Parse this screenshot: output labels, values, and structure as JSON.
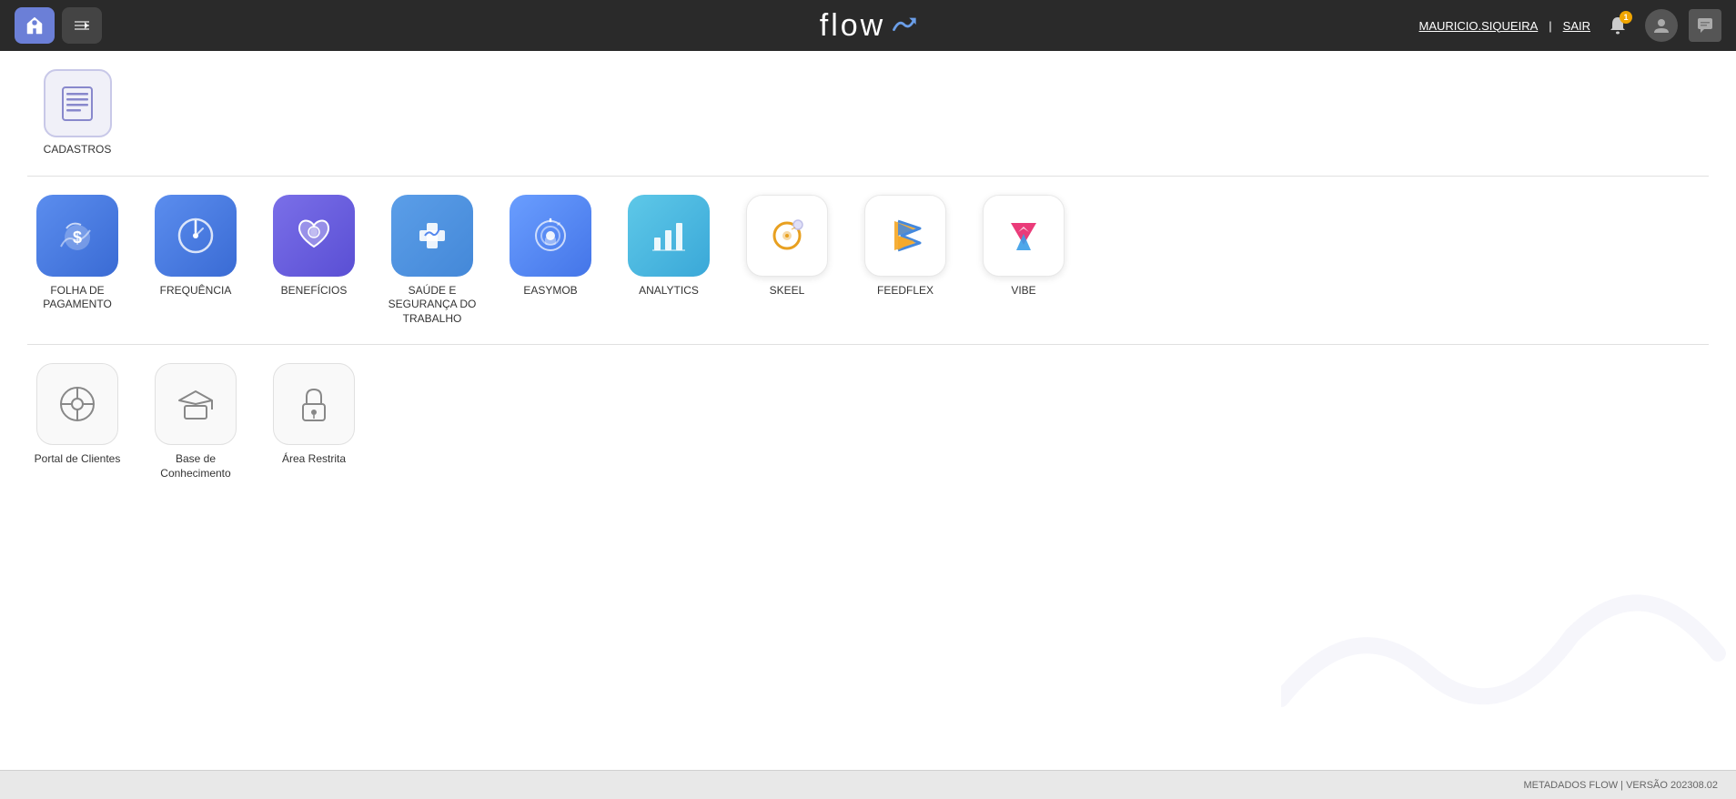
{
  "header": {
    "logo_text": "flow",
    "user_name": "MAURICIO.SIQUEIRA",
    "separator": "|",
    "logout_label": "SAIR",
    "notification_count": "1"
  },
  "cadastros": {
    "label": "CADASTROS"
  },
  "apps": {
    "items": [
      {
        "id": "folha",
        "label": "FOLHA DE PAGAMENTO",
        "bg": "blue-gradient"
      },
      {
        "id": "frequencia",
        "label": "FREQUÊNCIA",
        "bg": "blue-gradient"
      },
      {
        "id": "beneficios",
        "label": "BENEFÍCIOS",
        "bg": "purple-gradient"
      },
      {
        "id": "saude",
        "label": "SAÚDE E SEGURANÇA DO TRABALHO",
        "bg": "medium-blue"
      },
      {
        "id": "easymob",
        "label": "EASYMOB",
        "bg": "blue-gradient2"
      },
      {
        "id": "analytics",
        "label": "ANALYTICS",
        "bg": "teal-gradient"
      },
      {
        "id": "skeel",
        "label": "SKEEL",
        "bg": "white"
      },
      {
        "id": "feedflex",
        "label": "FEEDFLEX",
        "bg": "white"
      },
      {
        "id": "vibe",
        "label": "VIBE",
        "bg": "white"
      }
    ]
  },
  "tools": {
    "items": [
      {
        "id": "portal",
        "label": "Portal de Clientes"
      },
      {
        "id": "base",
        "label": "Base de Conhecimento"
      },
      {
        "id": "restrita",
        "label": "Área Restrita"
      }
    ]
  },
  "footer": {
    "text": "METADADOS FLOW | VERSÃO 2023​08.02"
  }
}
